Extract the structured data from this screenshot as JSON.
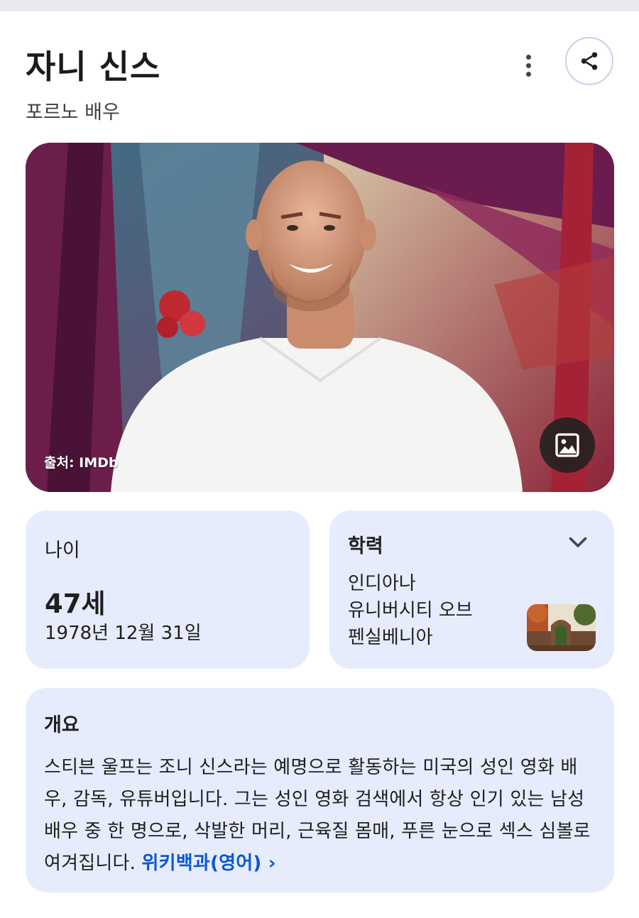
{
  "header": {
    "title": "자니 신스",
    "subtitle": "포르노 배우",
    "more_icon": "more-vert-icon",
    "share_icon": "share-icon"
  },
  "hero": {
    "credit": "출처: IMDb",
    "gallery_icon": "image-icon"
  },
  "age_card": {
    "label": "나이",
    "value": "47세",
    "birth_date": "1978년 12월 31일"
  },
  "education_card": {
    "label": "학력",
    "school_line1": "인디아나",
    "school_line2": "유니버시티 오브",
    "school_line3": "펜실베니아",
    "expand_icon": "chevron-down-icon"
  },
  "overview_card": {
    "label": "개요",
    "text": "스티븐 울프는 조니 신스라는 예명으로 활동하는 미국의 성인 영화 배우, 감독, 유튜버입니다. 그는 성인 영화 검색에서 항상 인기 있는 남성 배우 중 한 명으로, 삭발한 머리, 근육질 몸매, 푸른 눈으로 섹스 심볼로 여겨집니다.",
    "link": "위키백과(영어)",
    "link_arrow": "›"
  },
  "colors": {
    "card_bg": "#e6ecfb",
    "link": "#0b57d0",
    "title": "#1b1b1f"
  }
}
